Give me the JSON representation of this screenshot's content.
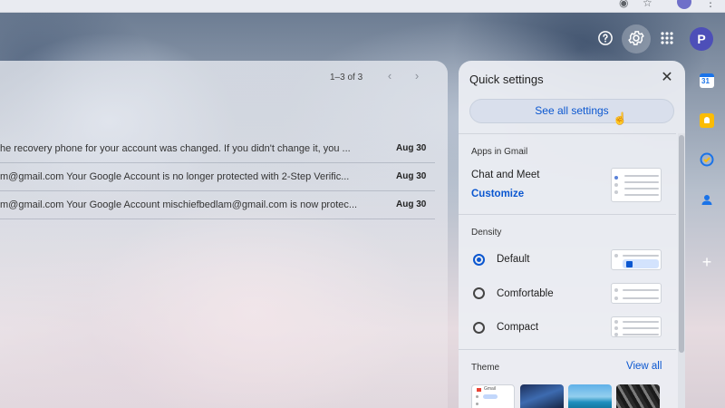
{
  "header": {
    "help_icon": "help-icon",
    "settings_icon": "gear-icon",
    "apps_icon": "apps-grid-icon",
    "avatar_initial": "P"
  },
  "mail": {
    "pager": "1–3 of 3",
    "rows": [
      {
        "snippet": "he recovery phone for your account was changed. If you didn't change it, you ...",
        "date": "Aug 30"
      },
      {
        "snippet": "m@gmail.com Your Google Account is no longer protected with 2-Step Verific...",
        "date": "Aug 30"
      },
      {
        "snippet": "m@gmail.com Your Google Account mischiefbedlam@gmail.com is now protec...",
        "date": "Aug 30"
      }
    ]
  },
  "quick_settings": {
    "title": "Quick settings",
    "see_all": "See all settings",
    "apps_in_gmail": "Apps in Gmail",
    "chat_and_meet": "Chat and Meet",
    "customize": "Customize",
    "density_label": "Density",
    "density_options": [
      {
        "label": "Default",
        "selected": true
      },
      {
        "label": "Comfortable",
        "selected": false
      },
      {
        "label": "Compact",
        "selected": false
      }
    ],
    "theme_label": "Theme",
    "view_all": "View all",
    "theme_thumb_text": "Gmail"
  },
  "side_panel": {
    "calendar_day": "31",
    "icons": [
      "calendar-icon",
      "keep-icon",
      "tasks-icon",
      "contacts-icon",
      "add-icon"
    ]
  },
  "colors": {
    "accent": "#0b57d0",
    "avatar": "#4d4fb8"
  }
}
